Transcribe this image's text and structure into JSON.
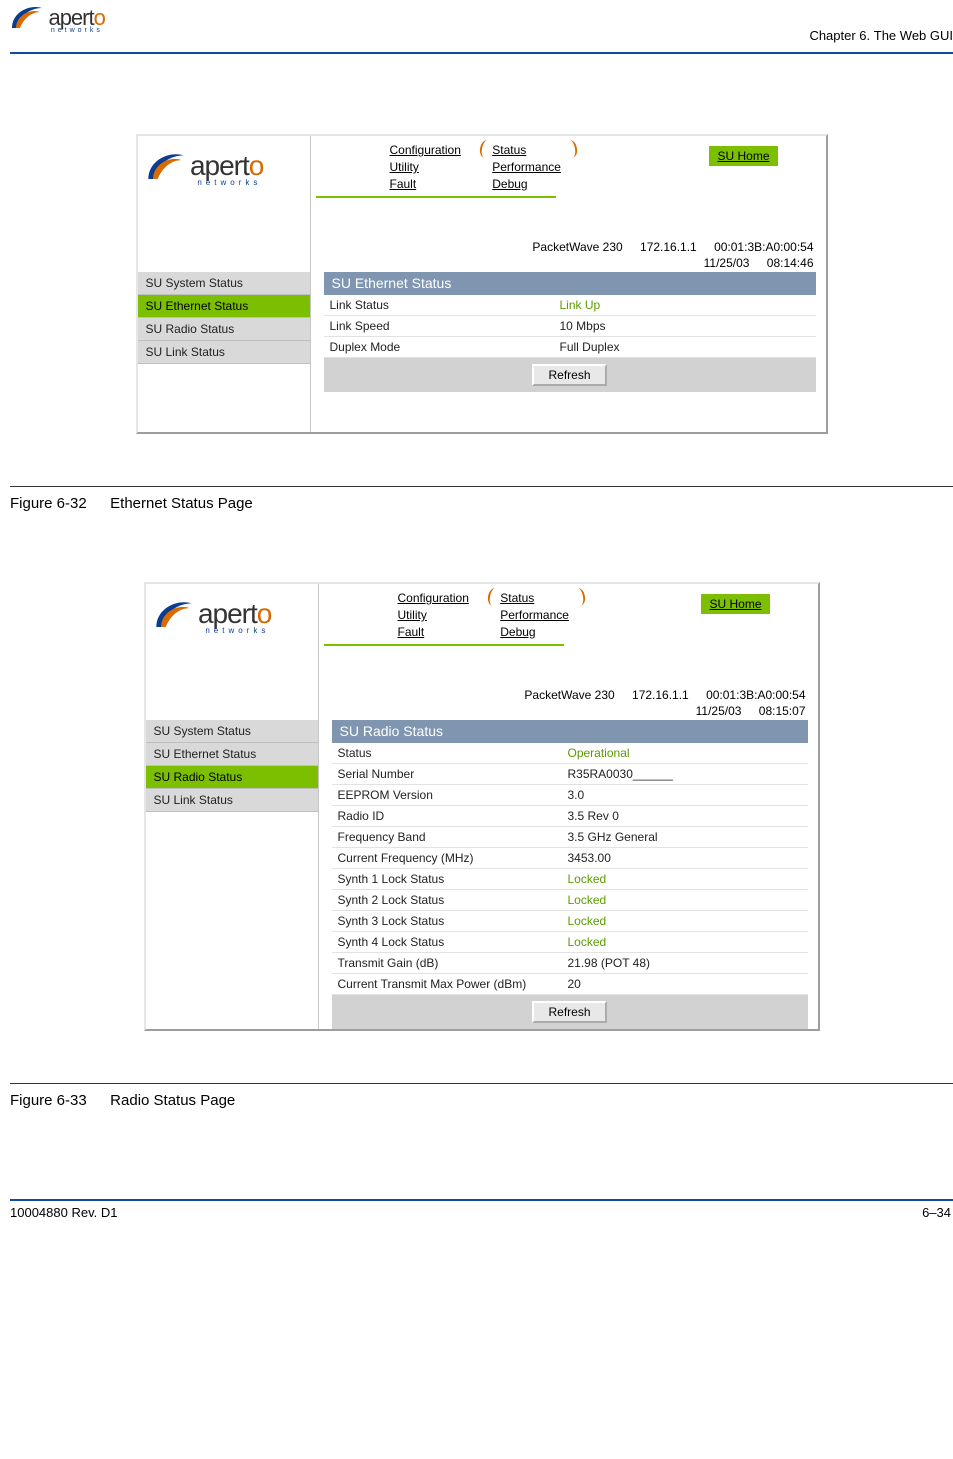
{
  "header": {
    "chapter_prefix": "Chapter 6.",
    "chapter_title": "The Web GUI"
  },
  "logo": {
    "word": "apert",
    "last_letter": "o",
    "sub": "networks"
  },
  "topnav": {
    "col1": [
      "Configuration",
      "Utility",
      "Fault"
    ],
    "col2": [
      "Status",
      "Performance",
      "Debug"
    ],
    "home": "SU Home"
  },
  "fig1": {
    "device_model": "PacketWave 230",
    "ip": "172.16.1.1",
    "mac": "00:01:3B:A0:00:54",
    "date": "11/25/03",
    "time": "08:14:46",
    "sidebar": [
      "SU System Status",
      "SU Ethernet Status",
      "SU Radio Status",
      "SU Link Status"
    ],
    "active_index": 1,
    "panel_title": "SU Ethernet Status",
    "rows": [
      {
        "k": "Link Status",
        "v": "Link Up",
        "green": true
      },
      {
        "k": "Link Speed",
        "v": "10 Mbps"
      },
      {
        "k": "Duplex Mode",
        "v": "Full Duplex"
      }
    ],
    "refresh": "Refresh",
    "caption_num": "Figure 6-32",
    "caption_text": "Ethernet Status Page"
  },
  "fig2": {
    "device_model": "PacketWave 230",
    "ip": "172.16.1.1",
    "mac": "00:01:3B:A0:00:54",
    "date": "11/25/03",
    "time": "08:15:07",
    "sidebar": [
      "SU System Status",
      "SU Ethernet Status",
      "SU Radio Status",
      "SU Link Status"
    ],
    "active_index": 2,
    "panel_title": "SU Radio Status",
    "rows": [
      {
        "k": "Status",
        "v": "Operational",
        "green": true
      },
      {
        "k": "Serial Number",
        "v": "R35RA0030______"
      },
      {
        "k": "EEPROM Version",
        "v": "3.0"
      },
      {
        "k": "Radio ID",
        "v": "3.5 Rev 0"
      },
      {
        "k": "Frequency Band",
        "v": "3.5 GHz General"
      },
      {
        "k": "Current Frequency (MHz)",
        "v": "3453.00"
      },
      {
        "k": "Synth 1 Lock Status",
        "v": "Locked",
        "green": true
      },
      {
        "k": "Synth 2 Lock Status",
        "v": "Locked",
        "green": true
      },
      {
        "k": "Synth 3 Lock Status",
        "v": "Locked",
        "green": true
      },
      {
        "k": "Synth 4 Lock Status",
        "v": "Locked",
        "green": true
      },
      {
        "k": "Transmit Gain (dB)",
        "v": "21.98 (POT 48)"
      },
      {
        "k": "Current Transmit Max Power (dBm)",
        "v": "20"
      }
    ],
    "refresh": "Refresh",
    "caption_num": "Figure 6-33",
    "caption_text": "Radio Status Page"
  },
  "footer": {
    "left": "10004880 Rev. D1",
    "right": "6–34"
  }
}
